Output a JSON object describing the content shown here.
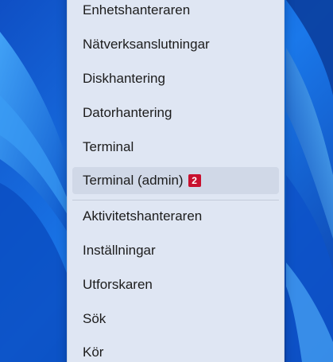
{
  "menu": {
    "items": [
      {
        "label": "Enhetshanteraren"
      },
      {
        "label": "Nätverksanslutningar"
      },
      {
        "label": "Diskhantering"
      },
      {
        "label": "Datorhantering"
      },
      {
        "label": "Terminal"
      },
      {
        "label": "Terminal (admin)",
        "badge": "2"
      },
      {
        "label": "Aktivitetshanteraren"
      },
      {
        "label": "Inställningar"
      },
      {
        "label": "Utforskaren"
      },
      {
        "label": "Sök"
      },
      {
        "label": "Kör"
      }
    ]
  },
  "colors": {
    "wallpaper": "#1565d8",
    "menu_background": "#dfe6f3",
    "hover": "#d0d8e7",
    "badge": "#c8102e"
  }
}
